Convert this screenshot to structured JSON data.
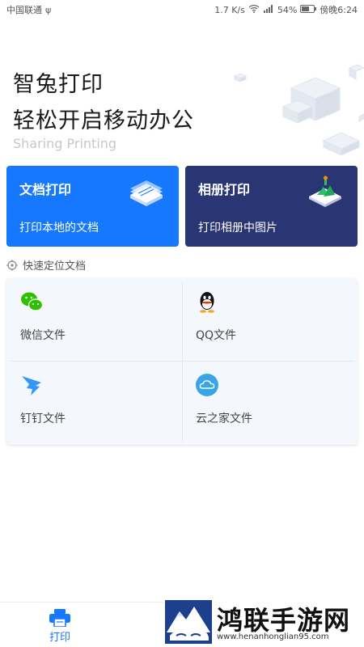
{
  "status_bar": {
    "carrier": "中国联通",
    "usb_icon": "usb-icon",
    "speed": "1.7 K/s",
    "battery": "54%",
    "time": "傍晚6:24"
  },
  "hero": {
    "title_line1": "智兔打印",
    "title_line2": "轻松开启移动办公",
    "subtitle": "Sharing Printing"
  },
  "cards": {
    "doc": {
      "title": "文档打印",
      "subtitle": "打印本地的文档",
      "color": "#1677ff",
      "icon": "document-stack-icon"
    },
    "album": {
      "title": "相册打印",
      "subtitle": "打印相册中图片",
      "color": "#2a3574",
      "icon": "photo-landscape-icon"
    }
  },
  "quick": {
    "label": "快速定位文档",
    "icon": "locate-icon"
  },
  "sources": [
    {
      "label": "微信文件",
      "icon": "wechat-icon",
      "color": "#2dc100"
    },
    {
      "label": "QQ文件",
      "icon": "qq-icon",
      "color": "#111111"
    },
    {
      "label": "钉钉文件",
      "icon": "dingtalk-icon",
      "color": "#3296fa"
    },
    {
      "label": "云之家文件",
      "icon": "cloud-icon",
      "color": "#3aa4e8"
    }
  ],
  "tabbar": {
    "print_label": "打印",
    "icon": "printer-icon",
    "color": "#1677ff"
  },
  "watermark": {
    "title": "鸿联手游网",
    "url": "www.henanhonglian95.com"
  }
}
